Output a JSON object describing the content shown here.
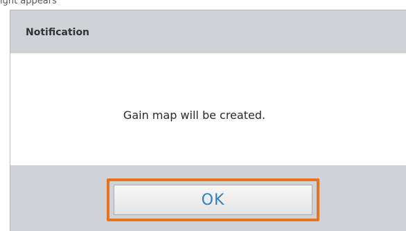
{
  "background": {
    "partial_text": "ight appears"
  },
  "dialog": {
    "title": "Notification",
    "message": "Gain map will be created.",
    "ok_label": "OK"
  },
  "colors": {
    "highlight": "#e8731f",
    "button_text": "#2f7fc1",
    "panel": "#cfd2d6"
  }
}
